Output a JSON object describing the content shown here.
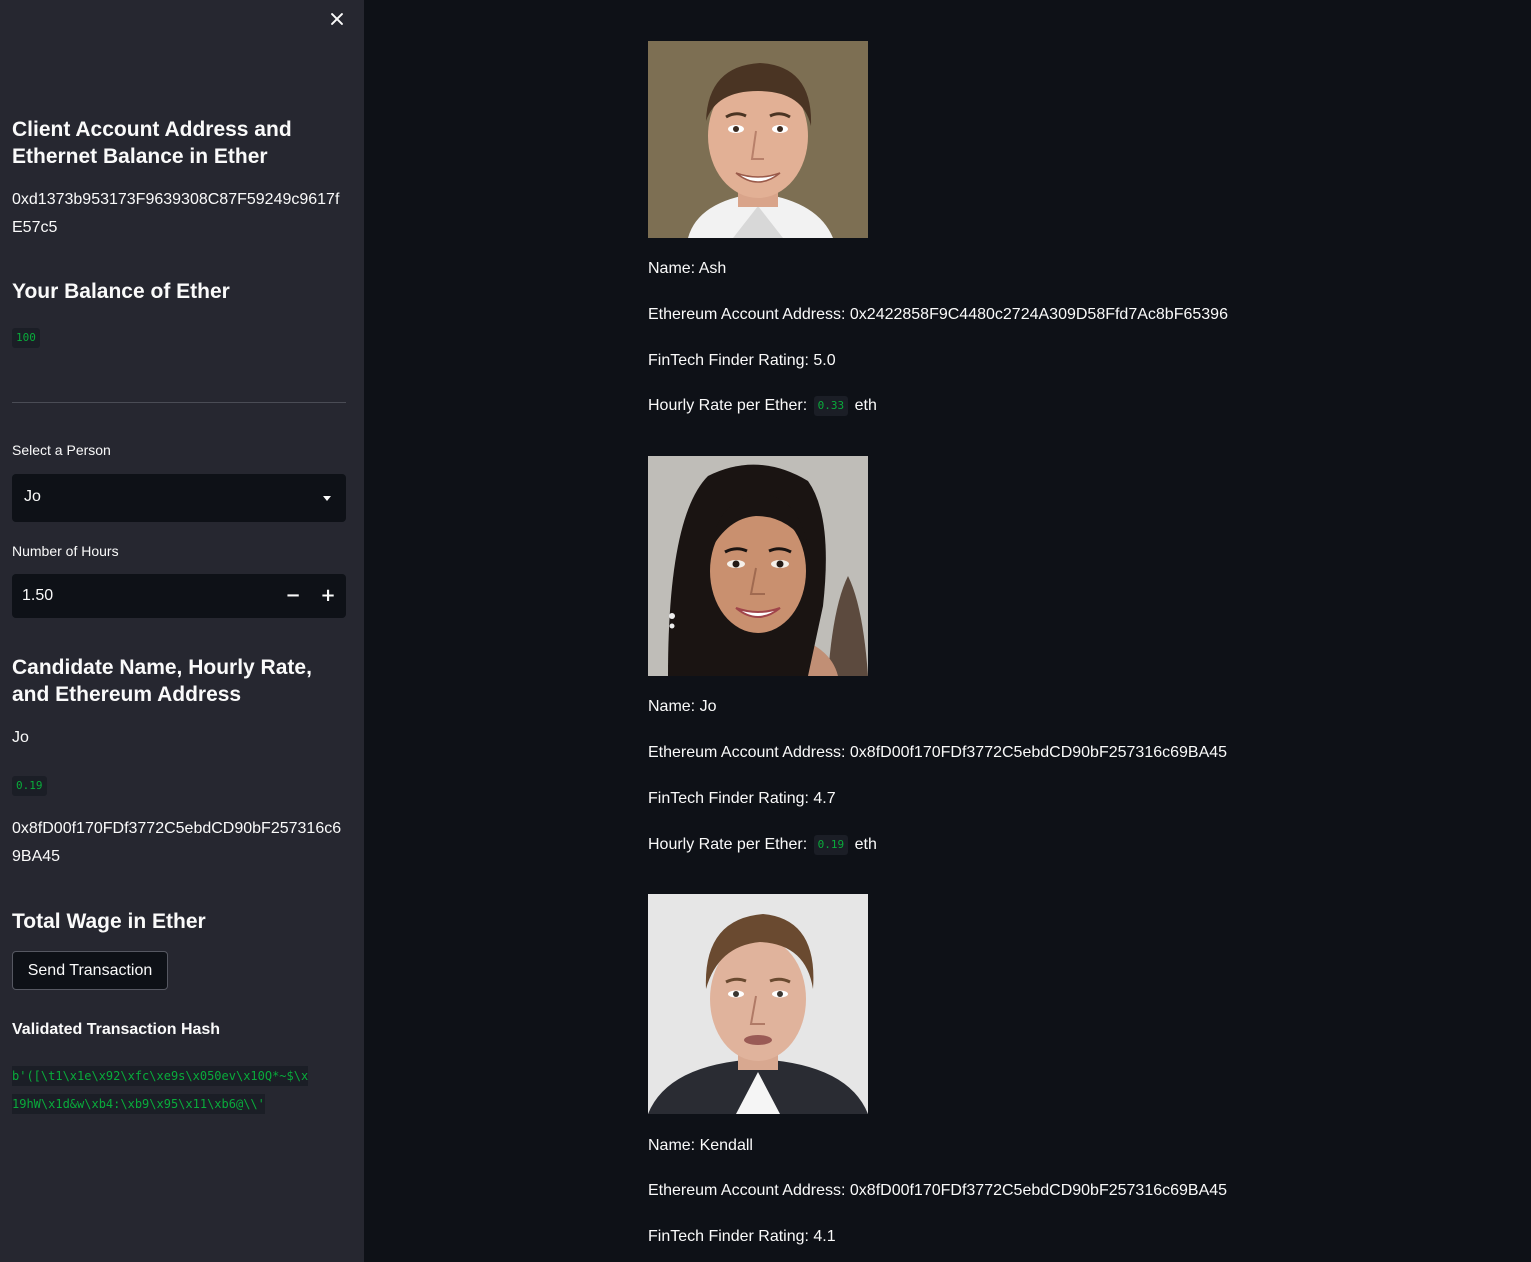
{
  "sidebar": {
    "account_heading": "Client Account Address and Ethernet Balance in Ether",
    "account_address": "0xd1373b953173F9639308C87F59249c9617fE57c5",
    "balance_heading": "Your Balance of Ether",
    "balance_value": "100",
    "select_person_label": "Select a Person",
    "selected_person": "Jo",
    "hours_label": "Number of Hours",
    "hours_value": "1.50",
    "candidate_heading": "Candidate Name, Hourly Rate, and Ethereum Address",
    "candidate_name": "Jo",
    "candidate_rate": "0.19",
    "candidate_address": "0x8fD00f170FDf3772C5ebdCD90bF257316c69BA45",
    "total_wage_heading": "Total Wage in Ether",
    "send_button_label": "Send Transaction",
    "tx_hash_heading": "Validated Transaction Hash",
    "tx_hash_line1": "b'([\\t1\\x1e\\x92\\xfc\\xe9s\\x050ev\\x10Q*~$\\x",
    "tx_hash_line2": "19hW\\x1d&w\\xb4:\\xb9\\x95\\x11\\xb6@\\\\'"
  },
  "candidates": [
    {
      "name_line": "Name: Ash",
      "address_line": "Ethereum Account Address: 0x2422858F9C4480c2724A309D58Ffd7Ac8bF65396",
      "rating_line": "FinTech Finder Rating: 5.0",
      "rate_prefix": "Hourly Rate per Ether:",
      "rate_value": "0.33",
      "rate_suffix": "eth"
    },
    {
      "name_line": "Name: Jo",
      "address_line": "Ethereum Account Address: 0x8fD00f170FDf3772C5ebdCD90bF257316c69BA45",
      "rating_line": "FinTech Finder Rating: 4.7",
      "rate_prefix": "Hourly Rate per Ether:",
      "rate_value": "0.19",
      "rate_suffix": "eth"
    },
    {
      "name_line": "Name: Kendall",
      "address_line": "Ethereum Account Address: 0x8fD00f170FDf3772C5ebdCD90bF257316c69BA45",
      "rating_line": "FinTech Finder Rating: 4.1"
    }
  ],
  "colors": {
    "app_background": "#0e1117",
    "sidebar_background": "#262730",
    "code_green": "#09ab3b"
  }
}
